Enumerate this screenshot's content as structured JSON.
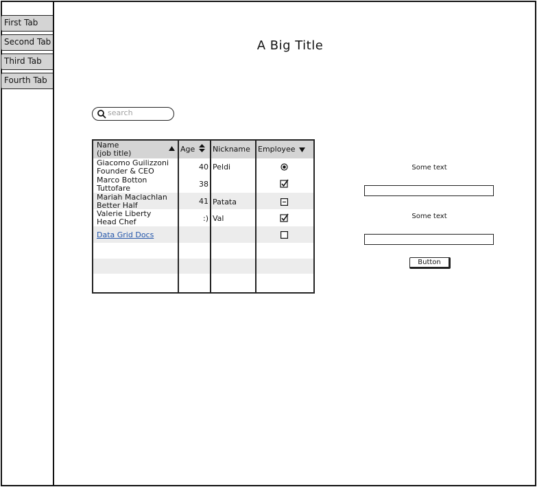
{
  "tabs": [
    {
      "label": "First Tab"
    },
    {
      "label": "Second Tab"
    },
    {
      "label": "Third Tab"
    },
    {
      "label": "Fourth Tab"
    }
  ],
  "title": "A Big Title",
  "search": {
    "placeholder": "search"
  },
  "grid": {
    "columns": {
      "name": "Name",
      "name_sub": "(job title)",
      "age": "Age",
      "nickname": "Nickname",
      "employee": "Employee"
    },
    "rows": [
      {
        "name": "Giacomo Guilizzoni",
        "title": "Founder & CEO",
        "age": "40",
        "nickname": "Peldi",
        "employee": "radio-selected"
      },
      {
        "name": "Marco Botton",
        "title": "Tuttofare",
        "age": "38",
        "nickname": "",
        "employee": "checked"
      },
      {
        "name": "Mariah Maclachlan",
        "title": "Better Half",
        "age": "41",
        "nickname": "Patata",
        "employee": "indeterminate"
      },
      {
        "name": "Valerie Liberty",
        "title": "Head Chef",
        "age": ":)",
        "nickname": "Val",
        "employee": "checked"
      }
    ],
    "link_row": {
      "label": "Data Grid Docs",
      "employee": "unchecked"
    }
  },
  "panel": {
    "text1": "Some text",
    "text2": "Some text",
    "button": "Button"
  }
}
